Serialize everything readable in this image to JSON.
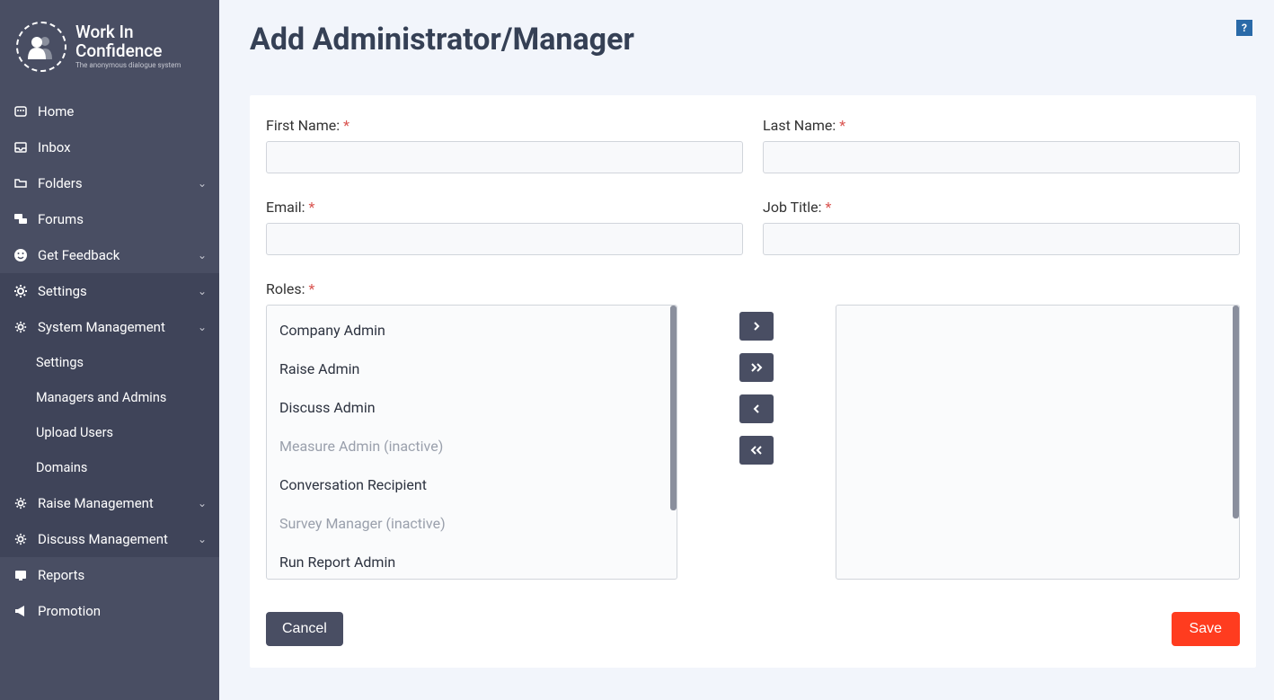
{
  "logo": {
    "title_line1": "Work In",
    "title_line2": "Confidence",
    "subtitle": "The anonymous dialogue system"
  },
  "sidebar": {
    "items": [
      {
        "label": "Home"
      },
      {
        "label": "Inbox"
      },
      {
        "label": "Folders"
      },
      {
        "label": "Forums"
      },
      {
        "label": "Get Feedback"
      },
      {
        "label": "Settings"
      },
      {
        "label": "System Management"
      },
      {
        "label": "Settings"
      },
      {
        "label": "Managers and Admins"
      },
      {
        "label": "Upload Users"
      },
      {
        "label": "Domains"
      },
      {
        "label": "Raise Management"
      },
      {
        "label": "Discuss Management"
      },
      {
        "label": "Reports"
      },
      {
        "label": "Promotion"
      }
    ]
  },
  "page": {
    "title": "Add Administrator/Manager",
    "help": "?"
  },
  "form": {
    "first_name_label": "First Name:",
    "last_name_label": "Last Name:",
    "email_label": "Email:",
    "job_title_label": "Job Title:",
    "roles_label": "Roles:",
    "first_name_value": "",
    "last_name_value": "",
    "email_value": "",
    "job_title_value": "",
    "roles_available": [
      {
        "label": "Company Admin",
        "inactive": false
      },
      {
        "label": "Raise Admin",
        "inactive": false
      },
      {
        "label": "Discuss Admin",
        "inactive": false
      },
      {
        "label": "Measure Admin (inactive)",
        "inactive": true
      },
      {
        "label": "Conversation Recipient",
        "inactive": false
      },
      {
        "label": "Survey Manager (inactive)",
        "inactive": true
      },
      {
        "label": "Run Report Admin",
        "inactive": false
      }
    ]
  },
  "buttons": {
    "cancel": "Cancel",
    "save": "Save"
  }
}
